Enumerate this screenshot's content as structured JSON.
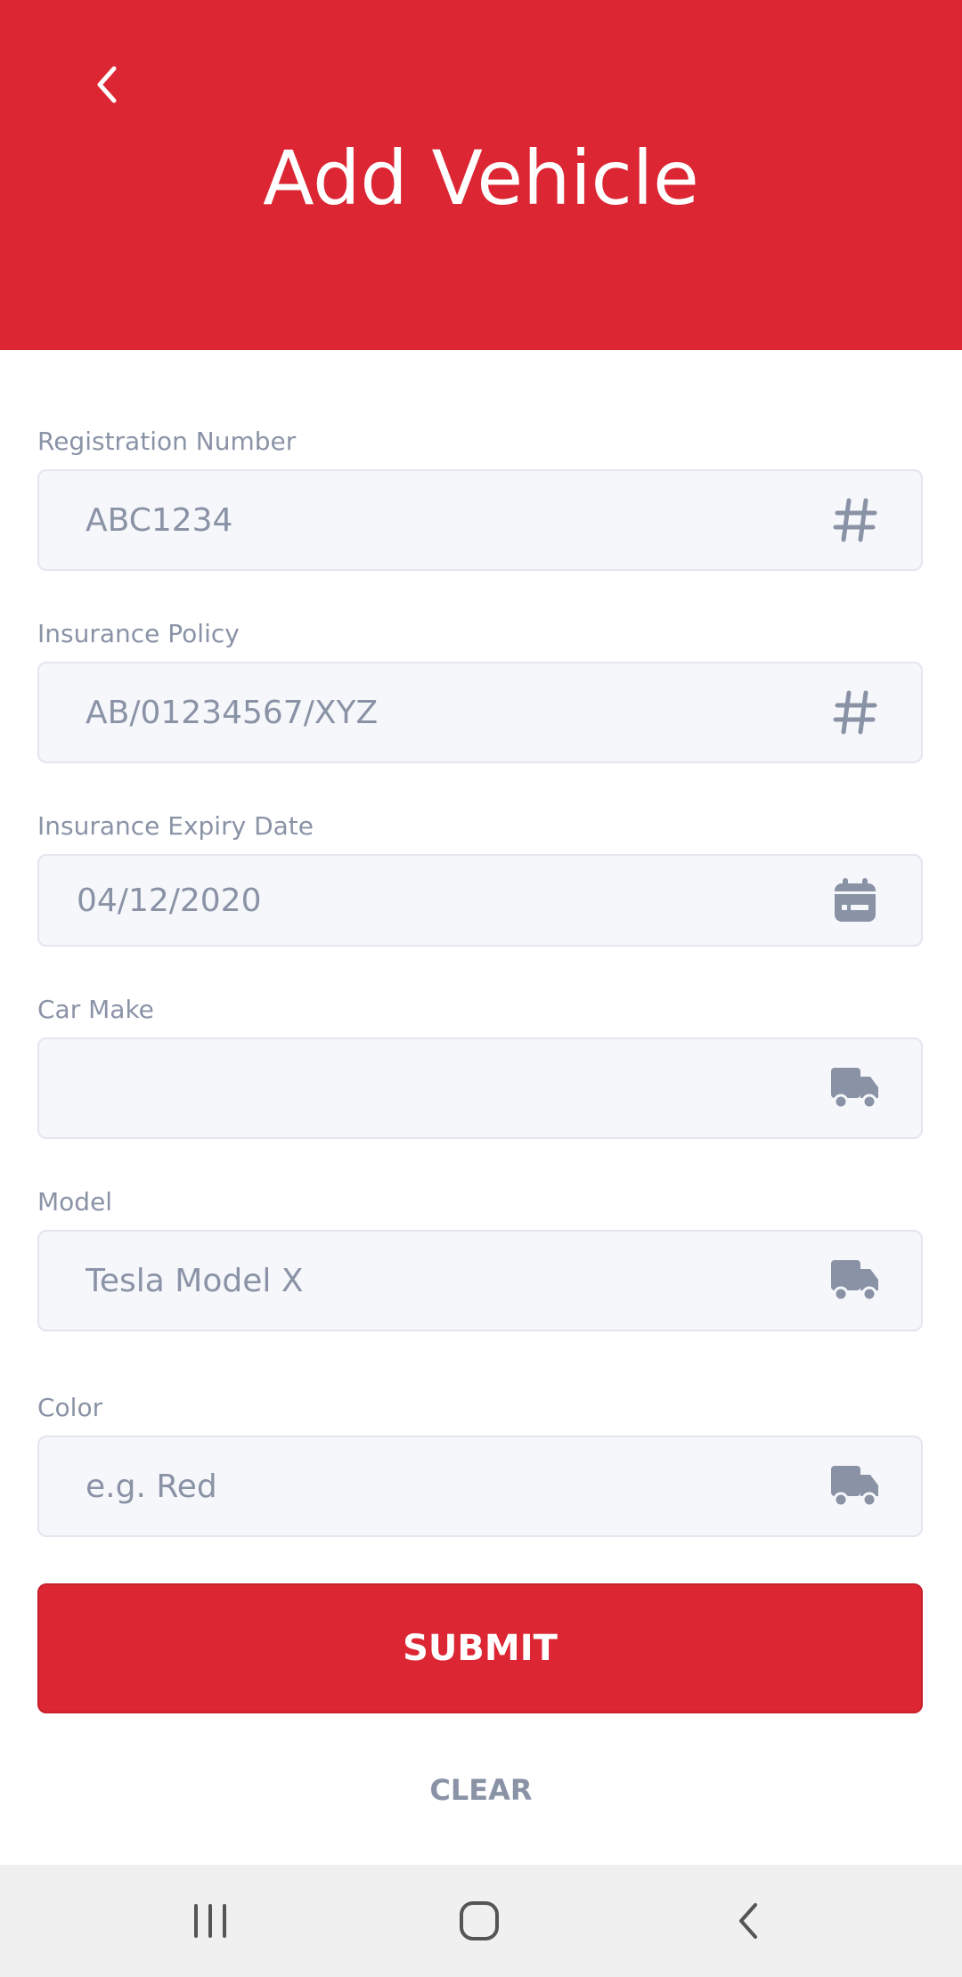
{
  "header": {
    "title": "Add Vehicle",
    "back_icon": "chevron-left-icon",
    "background_color": "#dc2633"
  },
  "form": {
    "fields": [
      {
        "label": "Registration Number",
        "value": "",
        "placeholder": "ABC1234",
        "icon": "hash-icon"
      },
      {
        "label": "Insurance Policy",
        "value": "",
        "placeholder": "AB/01234567/XYZ",
        "icon": "hash-icon"
      },
      {
        "label": "Insurance Expiry Date",
        "value": "04/12/2020",
        "placeholder": "",
        "icon": "calendar-icon"
      },
      {
        "label": "Car Make",
        "value": "",
        "placeholder": "",
        "icon": "truck-icon"
      },
      {
        "label": "Model",
        "value": "",
        "placeholder": "Tesla Model X",
        "icon": "truck-icon"
      },
      {
        "label": "Color",
        "value": "",
        "placeholder": "e.g. Red",
        "icon": "truck-icon"
      }
    ],
    "submit_label": "SUBMIT",
    "clear_label": "CLEAR",
    "accent_color": "#dc2633",
    "muted_color": "#8a93a6"
  },
  "system_nav": {
    "recents_icon": "recents-icon",
    "home_icon": "home-icon",
    "back_icon": "back-icon"
  }
}
